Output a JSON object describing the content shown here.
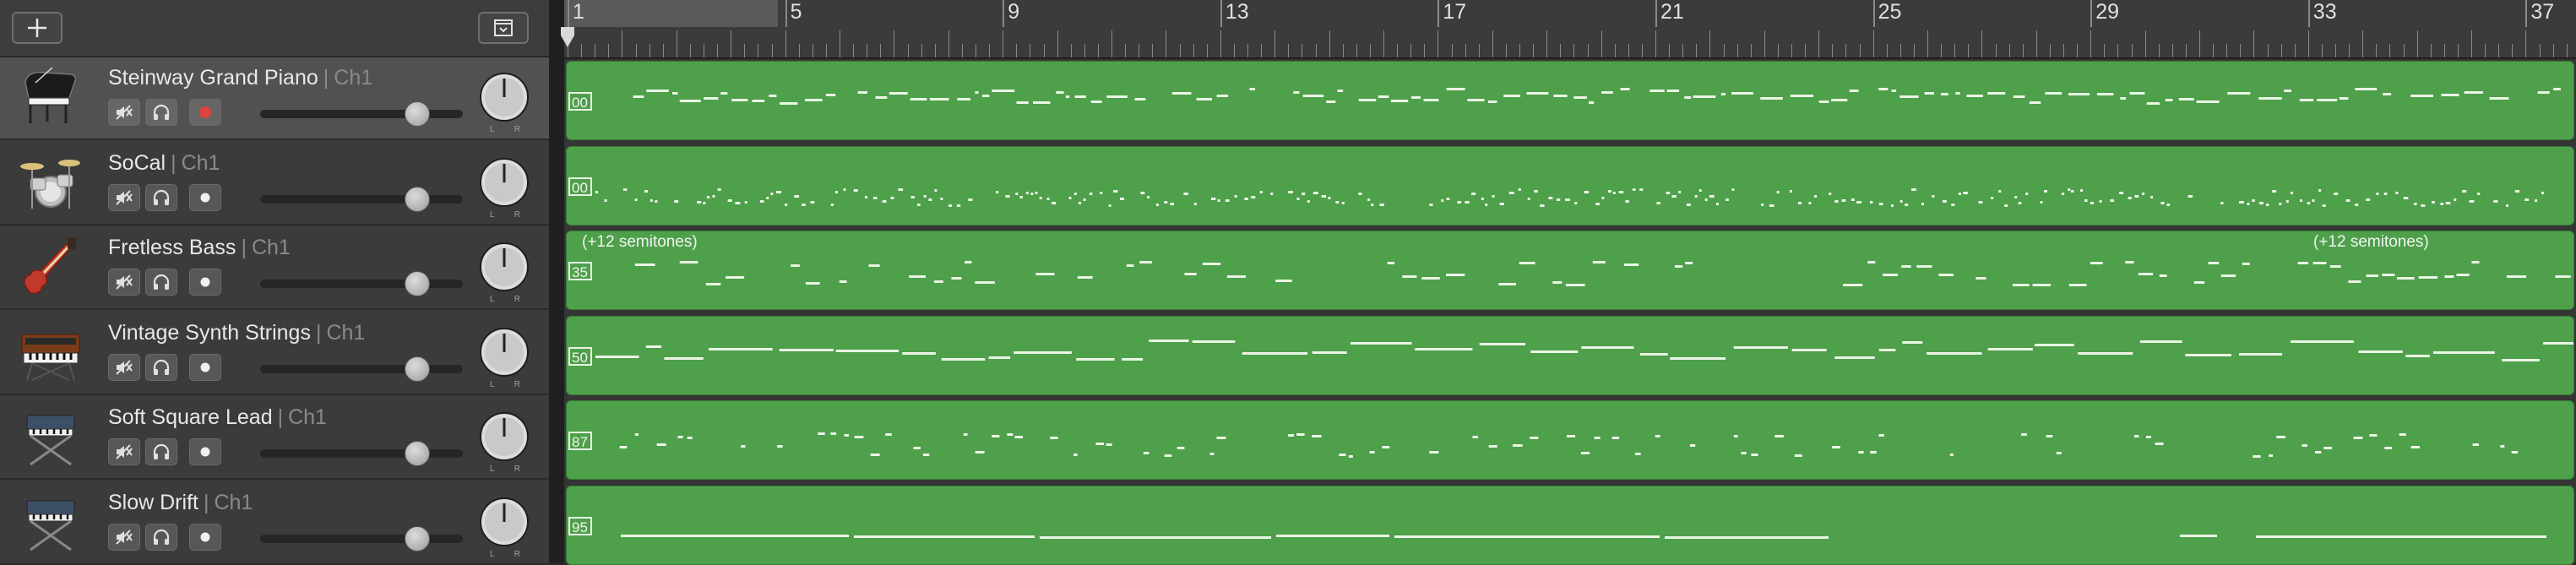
{
  "toolbar": {
    "add_icon": "plus-icon",
    "filter_icon": "track-header-menu-icon"
  },
  "ruler": {
    "bars": [
      "1",
      "5",
      "9",
      "13",
      "17",
      "21",
      "25",
      "29",
      "33",
      "37"
    ],
    "cycle_range": "1-5"
  },
  "tracks": [
    {
      "name": "Steinway Grand Piano",
      "channel": "Ch1",
      "icon": "grand-piano-icon",
      "selected": true,
      "record_armed": true,
      "region_start": "00",
      "region_label": ""
    },
    {
      "name": "SoCal",
      "channel": "Ch1",
      "icon": "drum-kit-icon",
      "selected": false,
      "record_armed": false,
      "region_start": "00",
      "region_label": ""
    },
    {
      "name": "Fretless Bass",
      "channel": "Ch1",
      "icon": "bass-guitar-icon",
      "selected": false,
      "record_armed": false,
      "region_start": "35",
      "region_label": "(+12 semitones)",
      "region_label_2": "(+12 semitones)"
    },
    {
      "name": "Vintage Synth Strings",
      "channel": "Ch1",
      "icon": "synth-keyboard-icon",
      "selected": false,
      "record_armed": false,
      "region_start": "50",
      "region_label": ""
    },
    {
      "name": "Soft Square Lead",
      "channel": "Ch1",
      "icon": "keyboard-stand-icon",
      "selected": false,
      "record_armed": false,
      "region_start": "87",
      "region_label": ""
    },
    {
      "name": "Slow Drift",
      "channel": "Ch1",
      "icon": "keyboard-stand-icon",
      "selected": false,
      "record_armed": false,
      "region_start": "95",
      "region_label": ""
    }
  ],
  "pan": {
    "left_label": "L",
    "right_label": "R"
  },
  "colors": {
    "region": "#4ea04a",
    "record": "#e0433f",
    "selected_header": "#515151"
  }
}
